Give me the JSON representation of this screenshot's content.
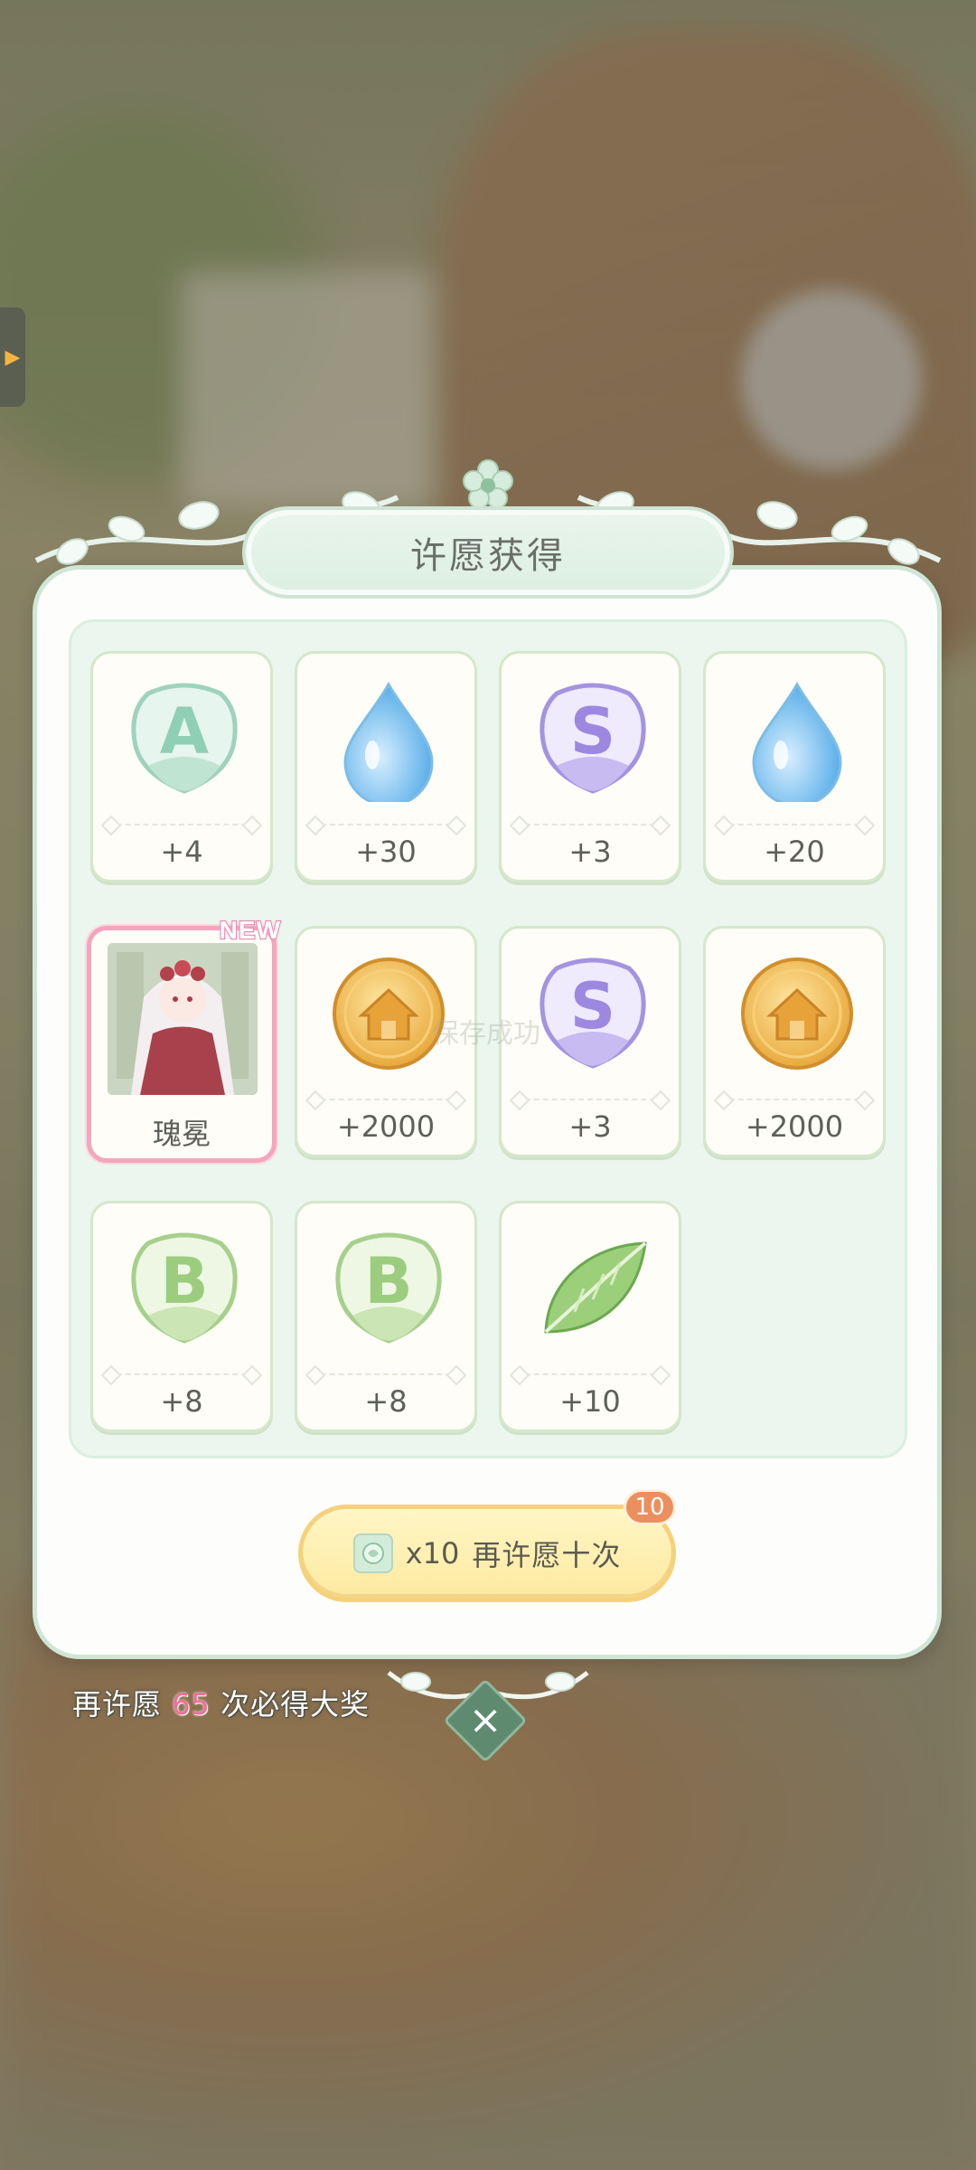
{
  "dialog": {
    "title": "许愿获得"
  },
  "rewards": [
    {
      "icon": "a-rank-badge-icon",
      "amount": "+4"
    },
    {
      "icon": "water-drop-icon",
      "amount": "+30"
    },
    {
      "icon": "s-rank-badge-icon",
      "amount": "+3"
    },
    {
      "icon": "water-drop-icon",
      "amount": "+20"
    },
    {
      "icon": "character-portrait",
      "amount": "瑰冕",
      "badge": "NEW"
    },
    {
      "icon": "gold-home-coin-icon",
      "amount": "+2000"
    },
    {
      "icon": "s-rank-badge-icon",
      "amount": "+3"
    },
    {
      "icon": "gold-home-coin-icon",
      "amount": "+2000"
    },
    {
      "icon": "b-rank-badge-icon",
      "amount": "+8"
    },
    {
      "icon": "b-rank-badge-icon",
      "amount": "+8"
    },
    {
      "icon": "green-leaf-icon",
      "amount": "+10"
    }
  ],
  "badges": {
    "a": "A",
    "s": "S",
    "b": "B"
  },
  "ghost_toast": "保存成功",
  "wish_button": {
    "count": "x10",
    "label": "再许愿十次",
    "badge": "10"
  },
  "pity": {
    "prefix": "再许愿",
    "count": "65",
    "suffix": "次必得大奖"
  },
  "colors": {
    "accent_green": "#5e8b70",
    "pink": "#f06d98",
    "gold": "#f5d27a"
  }
}
